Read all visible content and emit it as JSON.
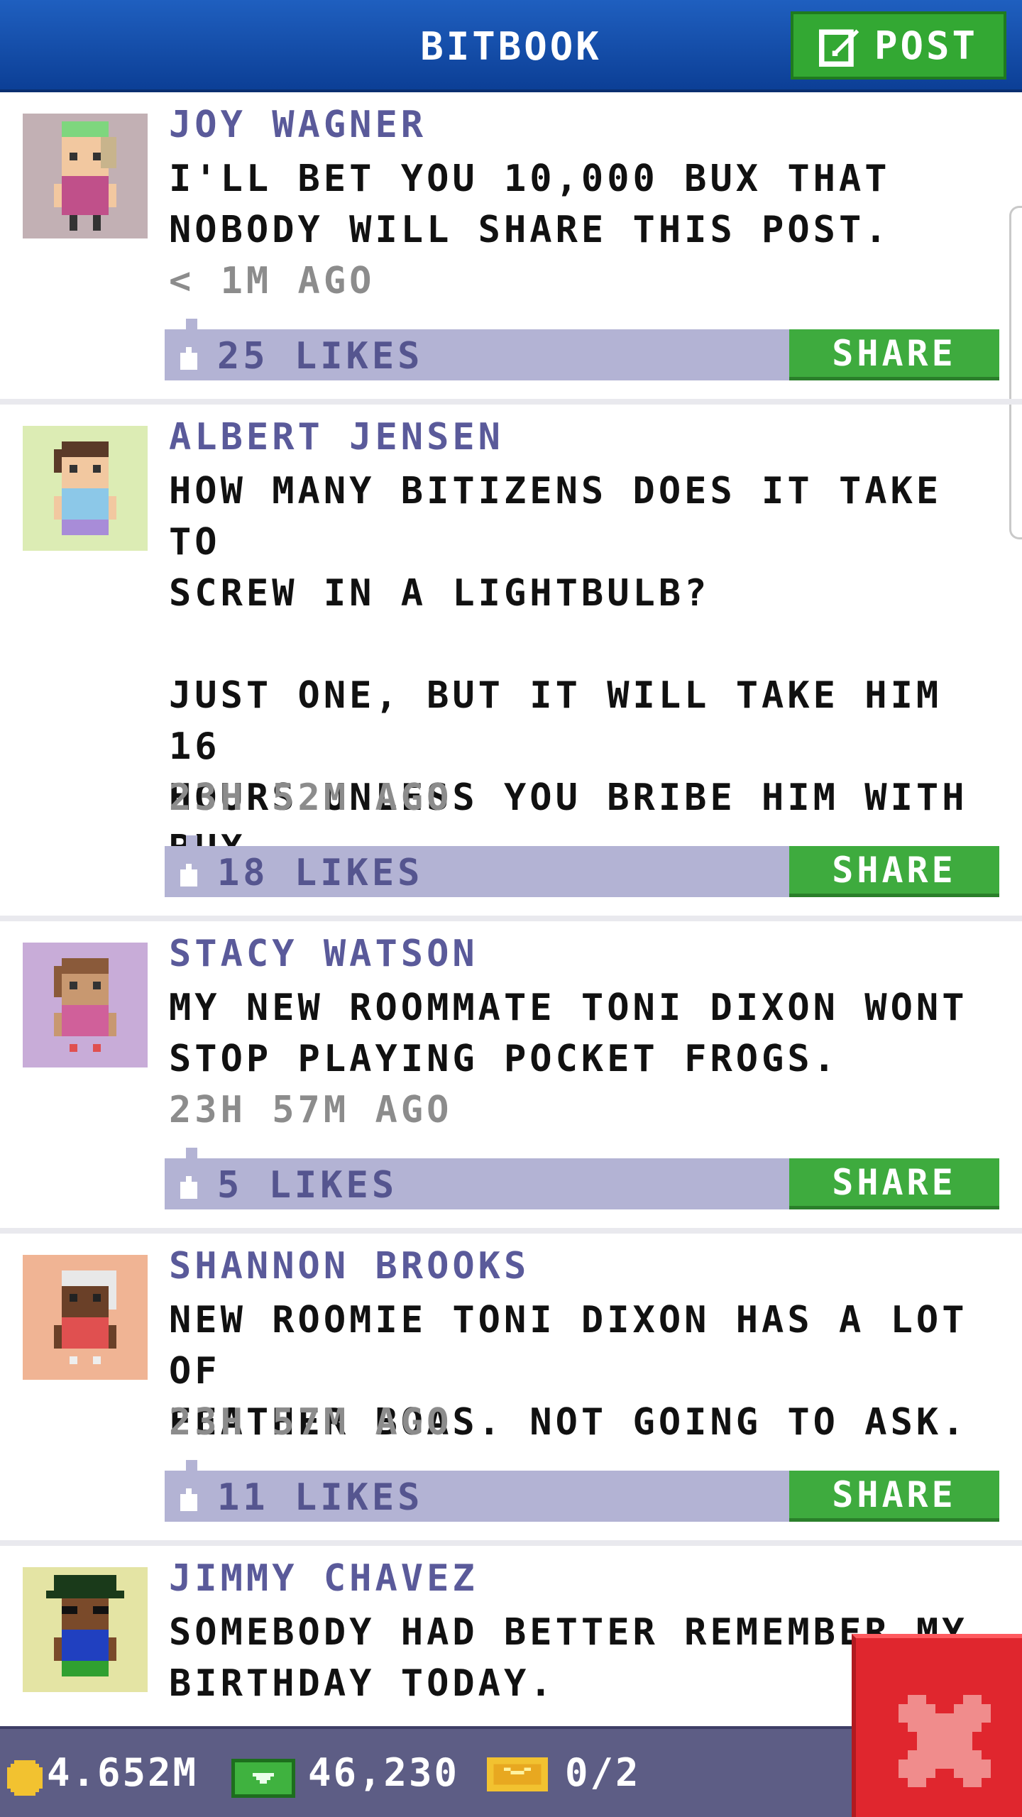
{
  "header": {
    "title": "BITBOOK",
    "post_label": "POST"
  },
  "posts": [
    {
      "author": "JOY WAGNER",
      "body": "I'LL BET YOU 10,000 BUX THAT\nNOBODY WILL SHARE THIS POST.",
      "time": "< 1M AGO",
      "likes": "25 LIKES",
      "share": "SHARE",
      "avatar_bg": "#c2b0b4"
    },
    {
      "author": "ALBERT JENSEN",
      "body": "HOW MANY BITIZENS DOES IT TAKE TO\nSCREW IN A LIGHTBULB?\n\nJUST ONE, BUT IT WILL TAKE HIM 16\nHOURS UNLESS YOU BRIBE HIM WITH\nBUX.",
      "time": "23H 52M AGO",
      "likes": "18 LIKES",
      "share": "SHARE",
      "avatar_bg": "#dcecb4"
    },
    {
      "author": "STACY WATSON",
      "body": "MY NEW ROOMMATE TONI DIXON WONT\nSTOP PLAYING POCKET FROGS.",
      "time": "23H 57M AGO",
      "likes": "5 LIKES",
      "share": "SHARE",
      "avatar_bg": "#c8acd8"
    },
    {
      "author": "SHANNON BROOKS",
      "body": "NEW ROOMIE TONI DIXON HAS A LOT OF\nFEATHER BOAS. NOT GOING TO ASK.",
      "time": "23H 57M AGO",
      "likes": "11 LIKES",
      "share": "SHARE",
      "avatar_bg": "#f0b494"
    },
    {
      "author": "JIMMY CHAVEZ",
      "body": "SOMEBODY HAD BETTER REMEMBER MY\nBIRTHDAY TODAY.",
      "avatar_bg": "#e4e4a4"
    }
  ],
  "status": {
    "coins": "4.652M",
    "bux": "46,230",
    "tickets": "0/2"
  },
  "icons": [
    "post-edit-icon",
    "like-thumb-icon",
    "coin-icon",
    "bux-icon",
    "ticket-icon",
    "close-icon"
  ],
  "colors": {
    "header": "#1a55b0",
    "share_green": "#3eab3e",
    "likes_bar": "#b3b3d4",
    "close_red": "#e0262e"
  }
}
